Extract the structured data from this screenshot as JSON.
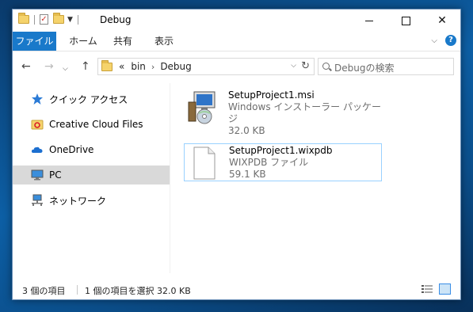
{
  "window": {
    "title": "Debug",
    "quick_access": [
      "folder-icon",
      "properties-icon",
      "new-folder-icon",
      "customize-arrow-icon"
    ],
    "controls": [
      "minimize",
      "maximize",
      "close"
    ]
  },
  "ribbon": {
    "tabs": [
      "ファイル",
      "ホーム",
      "共有",
      "表示"
    ]
  },
  "address": {
    "prefix": "«",
    "crumbs": [
      "bin",
      "Debug"
    ]
  },
  "search": {
    "placeholder": "Debugの検索"
  },
  "sidebar": {
    "items": [
      {
        "label": "クイック アクセス",
        "icon": "star-icon"
      },
      {
        "label": "Creative Cloud Files",
        "icon": "creative-cloud-icon"
      },
      {
        "label": "OneDrive",
        "icon": "cloud-icon"
      },
      {
        "label": "PC",
        "icon": "computer-icon",
        "selected": true
      },
      {
        "label": "ネットワーク",
        "icon": "network-icon"
      }
    ]
  },
  "files": [
    {
      "name": "SetupProject1.msi",
      "type": "Windows インストーラー パッケージ",
      "size": "32.0 KB",
      "icon": "installer-icon",
      "selected": false
    },
    {
      "name": "SetupProject1.wixpdb",
      "type": "WIXPDB ファイル",
      "size": "59.1 KB",
      "icon": "document-icon",
      "selected": true
    }
  ],
  "status": {
    "count": "3 個の項目",
    "selection": "1 個の項目を選択  32.0 KB"
  },
  "colors": {
    "accent": "#1979ca",
    "selection": "#d9d9d9",
    "focus_border": "#99d1ff"
  }
}
